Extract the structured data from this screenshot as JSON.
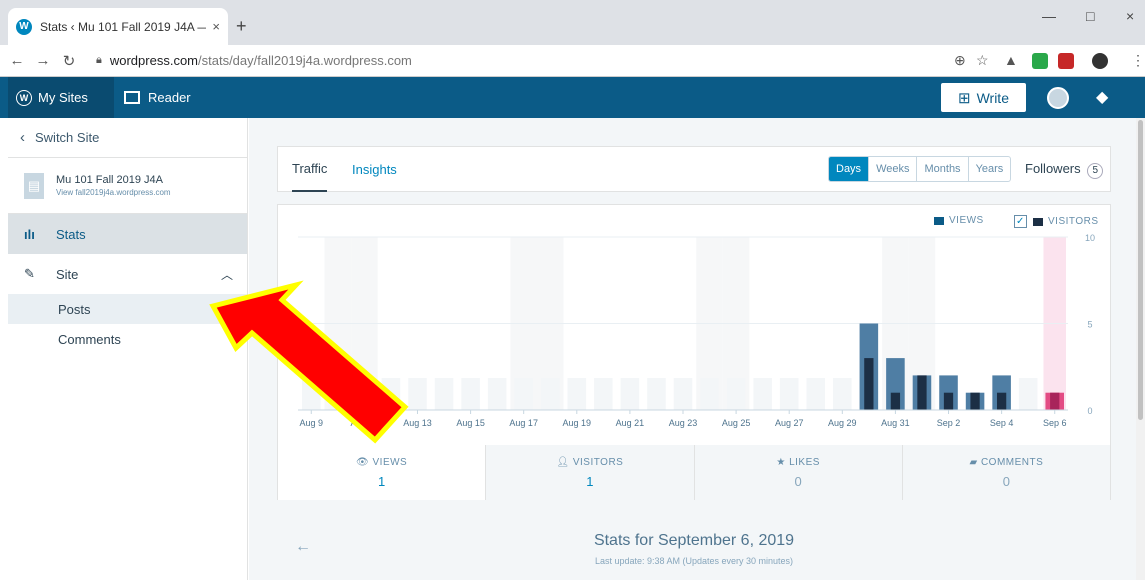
{
  "browser": {
    "tab_title": "Stats ‹ Mu 101 Fall 2019 J4A — W",
    "tab_close": "×",
    "new_tab": "+",
    "url_host": "wordpress.com",
    "url_path": "/stats/day/fall2019j4a.wordpress.com",
    "minimize": "—",
    "maximize": "□",
    "close": "×"
  },
  "masterbar": {
    "my_sites": "My Sites",
    "reader": "Reader",
    "write": "Write"
  },
  "sidebar": {
    "switch_site": "Switch Site",
    "site_name": "Mu 101 Fall 2019 J4A",
    "site_url": "View fall2019j4a.wordpress.com",
    "stats": "Stats",
    "site": "Site",
    "posts": "Posts",
    "comments": "Comments"
  },
  "stats_nav": {
    "tabs": [
      "Traffic",
      "Insights"
    ],
    "periods": [
      "Days",
      "Weeks",
      "Months",
      "Years"
    ],
    "active_period": "Days",
    "followers_label": "Followers",
    "followers_count": "5"
  },
  "legend": {
    "views": "VIEWS",
    "visitors": "VISITORS",
    "visitors_checked": true
  },
  "chart_data": {
    "type": "bar",
    "x": [
      "Aug 9",
      "Aug 10",
      "Aug 11",
      "Aug 12",
      "Aug 13",
      "Aug 14",
      "Aug 15",
      "Aug 16",
      "Aug 17",
      "Aug 18",
      "Aug 19",
      "Aug 20",
      "Aug 21",
      "Aug 22",
      "Aug 23",
      "Aug 24",
      "Aug 25",
      "Aug 26",
      "Aug 27",
      "Aug 28",
      "Aug 29",
      "Aug 30",
      "Aug 31",
      "Sep 1",
      "Sep 2",
      "Sep 3",
      "Sep 4",
      "Sep 5",
      "Sep 6"
    ],
    "tick_labels": [
      "Aug 9",
      "Aug 11",
      "Aug 13",
      "Aug 15",
      "Aug 17",
      "Aug 19",
      "Aug 21",
      "Aug 23",
      "Aug 25",
      "Aug 27",
      "Aug 29",
      "Aug 31",
      "Sep 2",
      "Sep 4",
      "Sep 6"
    ],
    "series": [
      {
        "name": "VIEWS",
        "values": [
          0,
          0,
          0,
          0,
          0,
          0,
          0,
          0,
          0,
          0,
          0,
          0,
          0,
          0,
          0,
          0,
          0,
          0,
          0,
          0,
          0,
          5,
          3,
          2,
          2,
          1,
          2,
          0,
          1
        ]
      },
      {
        "name": "VISITORS",
        "values": [
          0,
          0,
          0,
          0,
          0,
          0,
          0,
          0,
          0,
          0,
          0,
          0,
          0,
          0,
          0,
          0,
          0,
          0,
          0,
          0,
          0,
          3,
          1,
          2,
          1,
          1,
          1,
          0,
          1
        ]
      }
    ],
    "y_ticks": [
      "0",
      "5",
      "10"
    ],
    "ylim": [
      0,
      10
    ],
    "weekend_shading": true,
    "highlight": "Sep 6",
    "colors": {
      "views": "#4f7ea4",
      "visitors": "#1c2f45",
      "highlight_views": "#e34c84",
      "highlight_visitors": "#a8245b",
      "highlight_band": "#fbe3ee",
      "placeholder": "#f3f6f8"
    }
  },
  "metrics": [
    {
      "label": "VIEWS",
      "value": "1",
      "icon": "eye-icon"
    },
    {
      "label": "VISITORS",
      "value": "1",
      "icon": "person-icon"
    },
    {
      "label": "LIKES",
      "value": "0",
      "icon": "star-icon"
    },
    {
      "label": "COMMENTS",
      "value": "0",
      "icon": "speech-bubble-icon"
    }
  ],
  "summary": {
    "title": "Stats for September 6, 2019",
    "subtitle": "Last update: 9:38 AM (Updates every 30 minutes)"
  },
  "annotation": {
    "arrow_color": "#ff0000",
    "arrow_outline": "#ffff00"
  }
}
